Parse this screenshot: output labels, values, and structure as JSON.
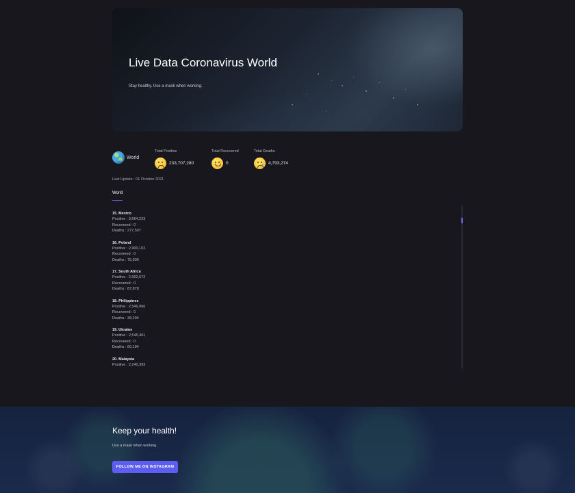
{
  "hero": {
    "title": "Live Data Coronavirus World",
    "subtitle": "Stay healthy. Use a mask when working."
  },
  "stats": {
    "region": "World",
    "region_icon": "globe-icon",
    "items": [
      {
        "label": "Total Positive",
        "value": "233,707,280",
        "icon": "sad-face-icon"
      },
      {
        "label": "Total Recovered",
        "value": "0",
        "icon": "smile-face-icon"
      },
      {
        "label": "Total Deaths",
        "value": "4,793,274",
        "icon": "crying-face-icon"
      }
    ]
  },
  "updated": "Last Update : 01 October 2021",
  "tabs": [
    {
      "label": "World",
      "active": true
    }
  ],
  "countries": [
    {
      "name": "15. Mexico",
      "positive": "Positive : 3,664,223",
      "recovered": "Recovered : 0",
      "deaths": "Deaths : 277,507"
    },
    {
      "name": "16. Poland",
      "positive": "Positive : 2,900,102",
      "recovered": "Recovered : 0",
      "deaths": "Deaths : 75,600"
    },
    {
      "name": "17. South Africa",
      "positive": "Positive : 2,902,672",
      "recovered": "Recovered : 0",
      "deaths": "Deaths : 87,878"
    },
    {
      "name": "18. Philippines",
      "positive": "Positive : 2,549,966",
      "recovered": "Recovered : 0",
      "deaths": "Deaths : 38,294"
    },
    {
      "name": "19. Ukraine",
      "positive": "Positive : 2,545,401",
      "recovered": "Recovered : 0",
      "deaths": "Deaths : 60,184"
    },
    {
      "name": "20. Malaysia",
      "positive": "Positive : 2,240,393",
      "recovered": "",
      "deaths": ""
    }
  ],
  "footer": {
    "title": "Keep your health!",
    "subtitle": "Use a mask when working.",
    "button": "FOLLOW ME ON INSTAGRAM"
  },
  "colors": {
    "background": "#18171d",
    "accent": "#5d5ef0",
    "footer_bg": "#16233f"
  }
}
